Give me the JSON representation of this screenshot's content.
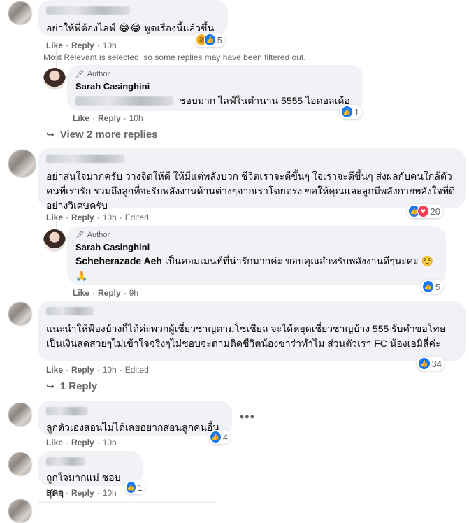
{
  "comments": [
    {
      "text": "อย่าให้พี่ต้องไลฟ์ 😂😂 พูดเรื่องนี้แล้วขึ้น",
      "reaction_count": "5",
      "actions": {
        "like": "Like",
        "reply": "Reply",
        "time": "10h"
      }
    },
    {
      "text": "อย่าสนใจมากครับ วางจิตให้ดี ให้มีแต่พลังบวก ชีวิตเราจะดีขึ้นๆ ใจเราจะดีขึ้นๆ ส่งผลกับคนใกล้ตัว คนที่เรารัก รวมถึงลูกที่จะรับพลังงานด้านต่างๆจากเราโดยตรง ขอให้คุณและลูกมีพลังกายพลังใจที่ดีอย่างวิเศษครับ",
      "reaction_count": "20",
      "actions": {
        "like": "Like",
        "reply": "Reply",
        "time": "10h",
        "edited": "Edited"
      }
    },
    {
      "text": "แนะนำให้ฟ้องบ้างก็ได้ค่ะพวกผู้เชี่ยวชาญตามโซเชียล จะได้หยุดเชี่ยวชาญบ้าง 555 รับคำขอโทษเป็นเงินสดสวยๆไม่เข้าใจจริงๆไม่ชอบจะตามติดชีวิตน้องซาร่าทำไม ส่วนตัวเรา FC น้องเอมิลี่ค่ะ",
      "reaction_count": "34",
      "actions": {
        "like": "Like",
        "reply": "Reply",
        "time": "10h",
        "edited": "Edited"
      }
    },
    {
      "text": "ลูกตัวเองสอนไม่ได้เลยอยากสอนลูกคนอื่น",
      "reaction_count": "4",
      "actions": {
        "like": "Like",
        "reply": "Reply",
        "time": "10h"
      }
    },
    {
      "text": "ถูกใจมากแม่ ชอบสุดๆ",
      "reaction_count": "1",
      "actions": {
        "like": "Like",
        "reply": "Reply",
        "time": "10h"
      }
    }
  ],
  "filter_note": "Most Relevant is selected, so some replies may have been filtered out.",
  "replies": [
    {
      "badge": "Author",
      "author": "Sarah Casinghini",
      "text": "ชอบมาก ไลฟ์ในตำนาน 5555 ไอดอลเด้อ",
      "reaction_count": "1",
      "actions": {
        "like": "Like",
        "reply": "Reply",
        "time": "10h"
      }
    },
    {
      "badge": "Author",
      "author": "Sarah Casinghini",
      "mention": "Scheherazade Aeh",
      "text": "เป็นคอมเมนท์ที่น่ารักมากค่ะ ขอบคุณสำหรับพลังงานดีๆนะคะ ☺️",
      "emoji2": "🙏",
      "reaction_count": "5",
      "actions": {
        "like": "Like",
        "reply": "Reply",
        "time": "9h"
      }
    }
  ],
  "view_more": {
    "first": "View 2 more replies",
    "third": "1 Reply"
  },
  "icons": {
    "like": "like-icon",
    "love": "love-icon",
    "haha": "haha-icon",
    "reply_arrow": "reply-arrow-icon",
    "more": "more-options-icon"
  },
  "colors": {
    "accent": "#1877f2",
    "bubble": "#f0f2f5",
    "muted": "#65676b"
  }
}
